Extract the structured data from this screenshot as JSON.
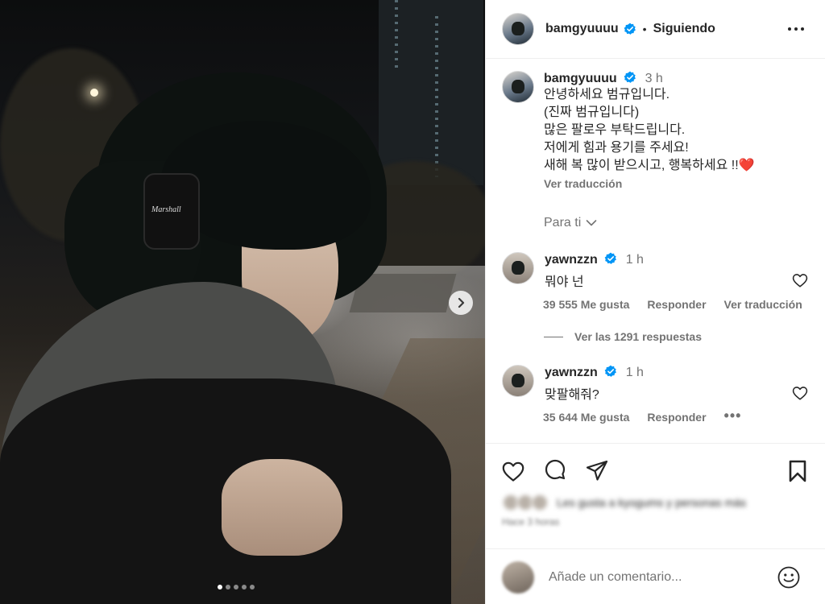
{
  "post": {
    "username": "bamgyuuuu",
    "follow_state": "Siguiendo",
    "headphone_brand": "Marshall",
    "carousel": {
      "total": 5,
      "active_index": 0
    }
  },
  "caption": {
    "username": "bamgyuuuu",
    "time": "3 h",
    "lines": [
      "안녕하세요 범규입니다.",
      "(진짜 범규입니다)",
      "많은 팔로우 부탁드립니다.",
      "저에게 힘과 용기를 주세요!",
      "새해 복 많이 받으시고, 행복하세요 !!❤️"
    ],
    "translate": "Ver traducción"
  },
  "filter": {
    "label": "Para ti"
  },
  "comments": [
    {
      "username": "yawnzzn",
      "time": "1 h",
      "text": "뭐야 넌",
      "likes": "39 555 Me gusta",
      "reply": "Responder",
      "translate": "Ver traducción",
      "replies": "Ver las 1291 respuestas"
    },
    {
      "username": "yawnzzn",
      "time": "1 h",
      "text": "맞팔해줘?",
      "likes": "35 644 Me gusta",
      "reply": "Responder",
      "more": "•••"
    }
  ],
  "footer": {
    "liked_by": "Les gusta a kyogums y personas más",
    "ago": "Hace 3 horas",
    "comment_placeholder": "Añade un comentario..."
  },
  "colors": {
    "verified": "#0095f6",
    "text": "#262626",
    "secondary": "#737373",
    "divider": "#efefef"
  },
  "icons": [
    "verified-icon",
    "more-options-icon",
    "chevron-down-icon",
    "heart-icon",
    "comment-icon",
    "share-icon",
    "bookmark-icon",
    "emoji-icon",
    "chevron-right-icon"
  ]
}
